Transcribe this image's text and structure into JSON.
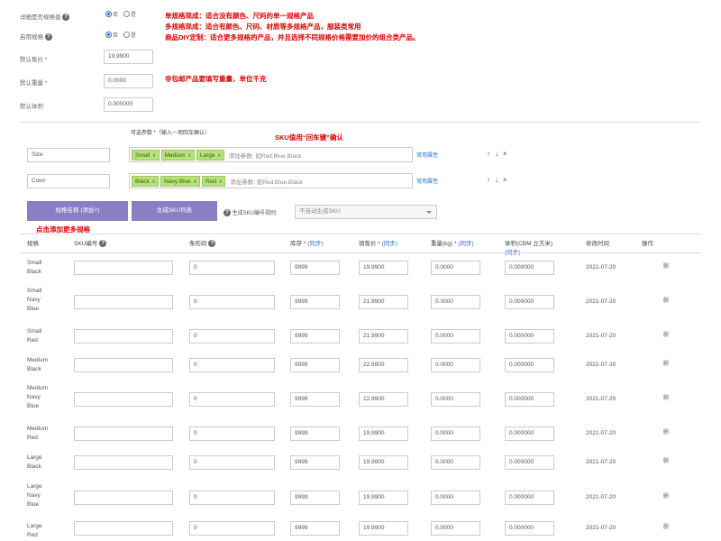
{
  "settings": {
    "spec_prompt": {
      "label": "详细是否规格值",
      "opt_yes": "否",
      "opt_no": "是"
    },
    "spec_enabled": {
      "label": "启用规格",
      "opt_yes": "否",
      "opt_no": "是"
    },
    "default_price": {
      "label": "默认售价 *",
      "value": "19.9900"
    },
    "default_weight": {
      "label": "默认重量 *",
      "value": "0.0000"
    },
    "default_volume": {
      "label": "默认体积",
      "value": "0.000000"
    }
  },
  "notes": {
    "line1": "单规格现成：适合没有颜色、尺码的单一规格产品",
    "line2": "多规格现成：适合有颜色、尺码、材质等多规格产品，服装类常用",
    "line3": "商品DIY定制：适合更多规格的产品，并且选择不同规格价格需要加价的组合类产品。",
    "weight": "非包邮产品要填写重量，单位千克",
    "sku_enter": "SKU值用“回车键”确认",
    "add_more": "点击添加更多规格"
  },
  "spec_header": "可选参数 *（输入一项回车确认）",
  "specs": [
    {
      "name": "Size",
      "tags": [
        "Small",
        "Medium",
        "Large"
      ],
      "placeholder": "添加参数: 如Red,Blue,Black",
      "link": "常用属性"
    },
    {
      "name": "Color",
      "tags": [
        "Black",
        "Navy Blue",
        "Red"
      ],
      "placeholder": "添加参数: 如Red,Blue,Black",
      "link": "常用属性"
    }
  ],
  "controls": {
    "up": "↑",
    "down": "↓",
    "remove": "×",
    "tag_remove": "x"
  },
  "buttons": {
    "add_spec": "规格名称 (添加+)",
    "gen_sku": "生成SKU列表"
  },
  "sku_gen": {
    "label": "生成SKU编号规则:",
    "select": "不自动生成SKU"
  },
  "table": {
    "headers": {
      "spec": "规格",
      "sku": "SKU编号",
      "barcode": "条形码",
      "stock": "库存 *",
      "price": "销售价 *",
      "weight": "重量(kg) *",
      "volume": "体积(CBM 立方米)",
      "date": "修改时间",
      "action": "操作",
      "sync": "(同步)"
    },
    "rows": [
      {
        "name": [
          "Small",
          "Black"
        ],
        "barcode": "0",
        "stock": "9999",
        "price": "19.9900",
        "weight": "0.0000",
        "volume": "0.000000",
        "date": "2021-07-20",
        "action": "删"
      },
      {
        "name": [
          "Small",
          "Navy",
          "Blue"
        ],
        "barcode": "0",
        "stock": "9999",
        "price": "21.9900",
        "weight": "0.0000",
        "volume": "0.000000",
        "date": "2021-07-20",
        "action": "删"
      },
      {
        "name": [
          "Small",
          "Red"
        ],
        "barcode": "0",
        "stock": "9999",
        "price": "21.9900",
        "weight": "0.0000",
        "volume": "0.000000",
        "date": "2021-07-20",
        "action": "删"
      },
      {
        "name": [
          "Medium",
          "Black"
        ],
        "barcode": "0",
        "stock": "9999",
        "price": "22.9900",
        "weight": "0.0000",
        "volume": "0.000000",
        "date": "2021-07-20",
        "action": "删"
      },
      {
        "name": [
          "Medium",
          "Navy",
          "Blue"
        ],
        "barcode": "0",
        "stock": "9999",
        "price": "22.9900",
        "weight": "0.0000",
        "volume": "0.000000",
        "date": "2021-07-20",
        "action": "删"
      },
      {
        "name": [
          "Medium",
          "Red"
        ],
        "barcode": "0",
        "stock": "9999",
        "price": "19.9900",
        "weight": "0.0000",
        "volume": "0.000000",
        "date": "2021-07-20",
        "action": "删"
      },
      {
        "name": [
          "Large",
          "Black"
        ],
        "barcode": "0",
        "stock": "9999",
        "price": "19.9900",
        "weight": "0.0000",
        "volume": "0.000000",
        "date": "2021-07-20",
        "action": "删"
      },
      {
        "name": [
          "Large",
          "Navy",
          "Blue"
        ],
        "barcode": "0",
        "stock": "9999",
        "price": "19.9900",
        "weight": "0.0000",
        "volume": "0.000000",
        "date": "2021-07-20",
        "action": "删"
      },
      {
        "name": [
          "Large",
          "Red"
        ],
        "barcode": "0",
        "stock": "9999",
        "price": "19.9900",
        "weight": "0.0000",
        "volume": "0.000000",
        "date": "2021-07-20",
        "action": "删"
      }
    ]
  },
  "colors": {
    "note_red": "#e00000",
    "tag_green": "#b7e27a",
    "button_purple": "#8a7fc4",
    "link_blue": "#2a6fd6"
  }
}
